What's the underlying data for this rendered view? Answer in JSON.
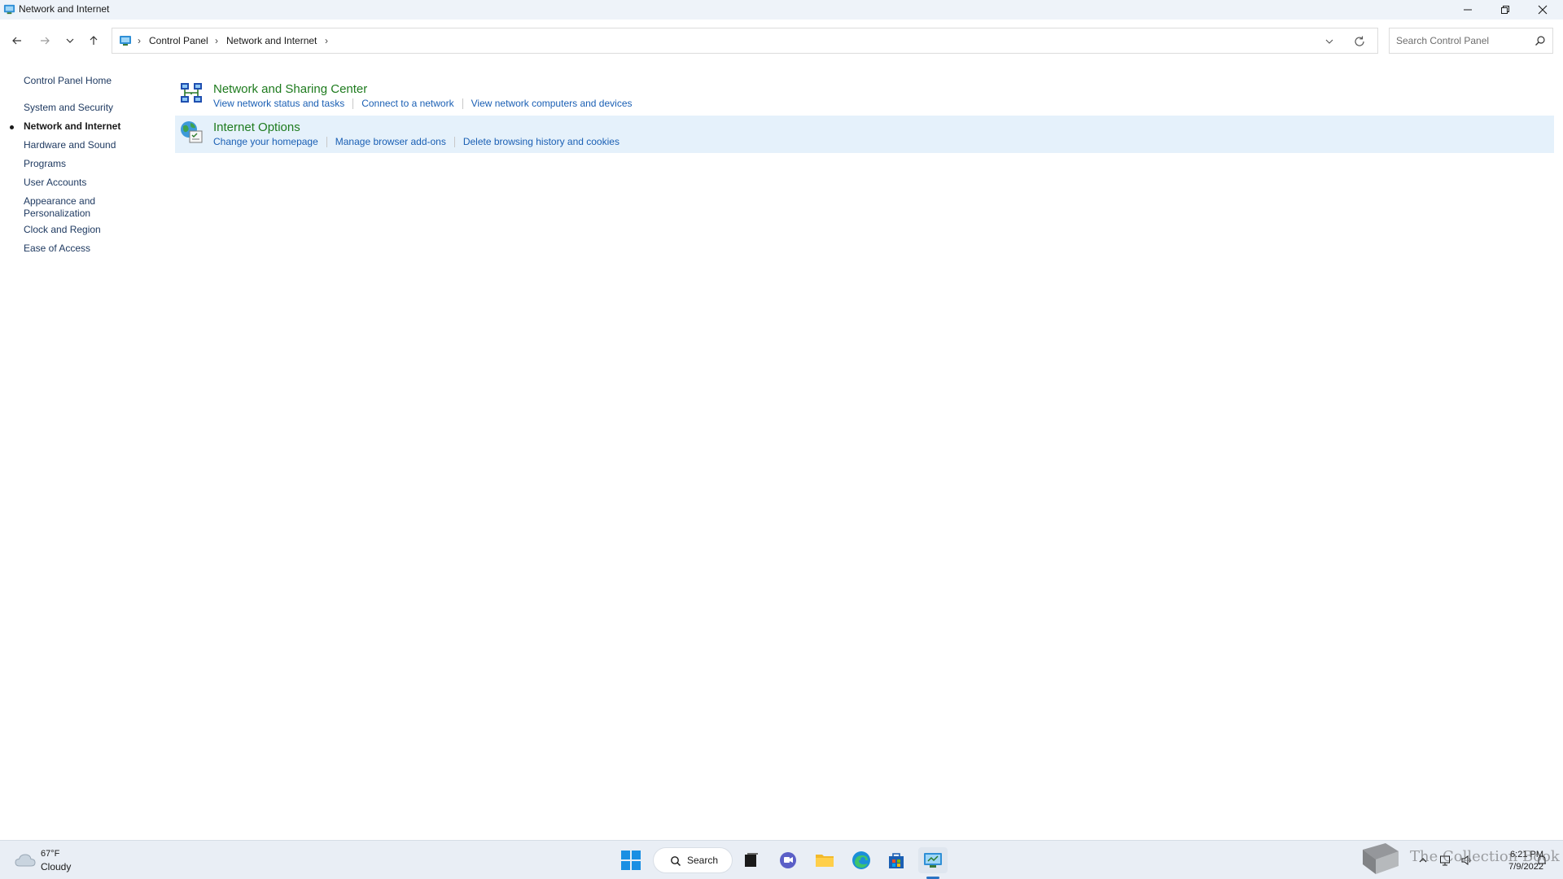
{
  "window": {
    "title": "Network and Internet"
  },
  "address": {
    "breadcrumbs": [
      "Control Panel",
      "Network and Internet"
    ],
    "search_placeholder": "Search Control Panel"
  },
  "sidebar": {
    "home": "Control Panel Home",
    "items": [
      {
        "label": "System and Security",
        "active": false
      },
      {
        "label": "Network and Internet",
        "active": true
      },
      {
        "label": "Hardware and Sound",
        "active": false
      },
      {
        "label": "Programs",
        "active": false
      },
      {
        "label": "User Accounts",
        "active": false
      },
      {
        "label": "Appearance and",
        "label2": "Personalization",
        "active": false
      },
      {
        "label": "Clock and Region",
        "active": false
      },
      {
        "label": "Ease of Access",
        "active": false
      }
    ]
  },
  "categories": [
    {
      "title": "Network and Sharing Center",
      "icon": "network-sharing-icon",
      "links": [
        "View network status and tasks",
        "Connect to a network",
        "View network computers and devices"
      ]
    },
    {
      "title": "Internet Options",
      "icon": "internet-options-icon",
      "links": [
        "Change your homepage",
        "Manage browser add-ons",
        "Delete browsing history and cookies"
      ]
    }
  ],
  "taskbar": {
    "weather_temp": "67°F",
    "weather_condition": "Cloudy",
    "search_label": "Search",
    "time": "6:21 PM",
    "date": "7/9/2022"
  },
  "watermark": {
    "text": "The Collection Book"
  },
  "colors": {
    "link": "#1a5fb4",
    "category_title": "#1e7b1e",
    "highlight": "#e5f1fb",
    "taskbar": "#e9eef5"
  }
}
